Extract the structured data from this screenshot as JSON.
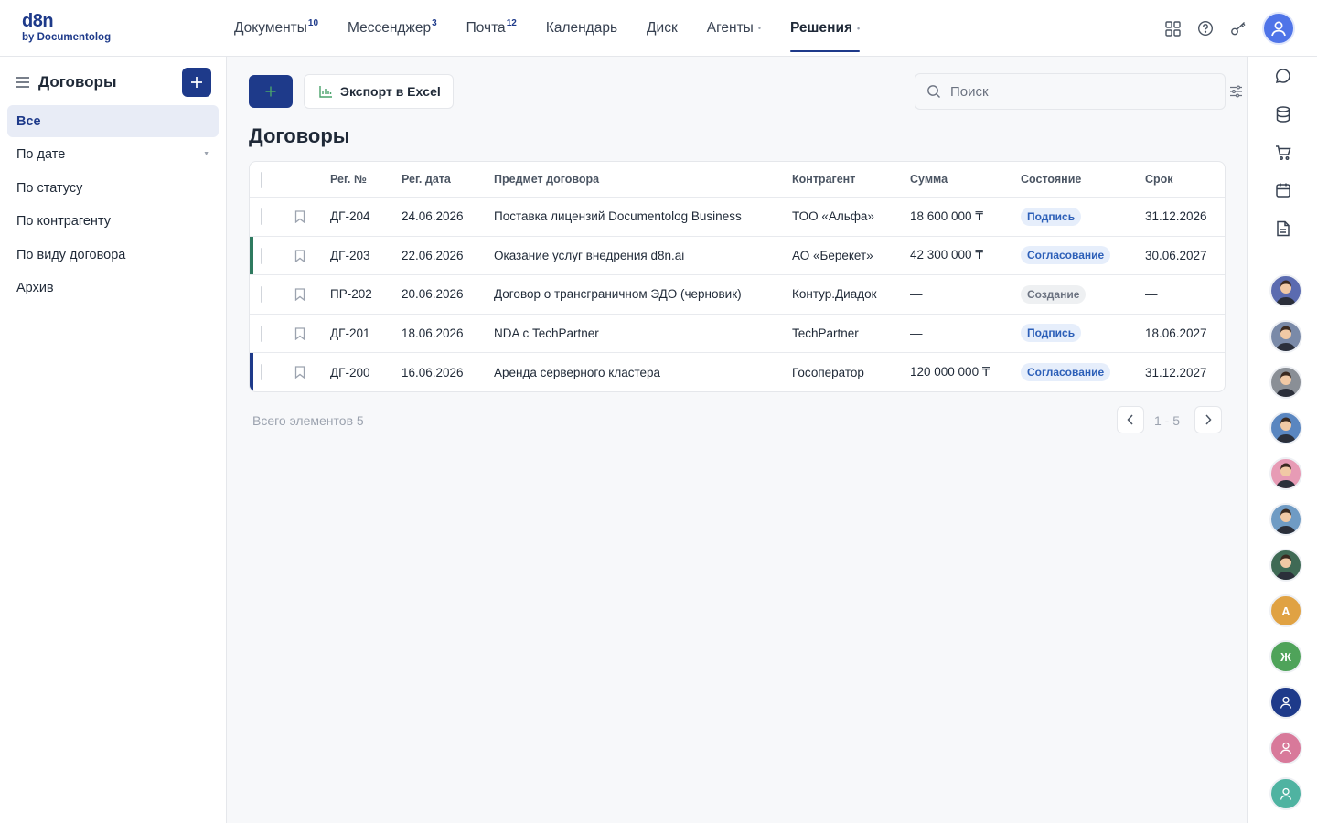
{
  "app": {
    "logo_line1": "d8n",
    "logo_line2": "by Documentolog",
    "brand_color": "#1e3a8a"
  },
  "nav": {
    "items": [
      {
        "label": "Документы",
        "badge": "10"
      },
      {
        "label": "Мессенджер",
        "badge": "3"
      },
      {
        "label": "Почта",
        "badge": "12"
      },
      {
        "label": "Календарь"
      },
      {
        "label": "Диск"
      },
      {
        "label": "Агенты",
        "dot": "•"
      },
      {
        "label": "Решения",
        "dot": "•",
        "active": true
      }
    ],
    "actions": [
      "apps-grid-icon",
      "help-icon",
      "key-icon",
      "user-avatar"
    ]
  },
  "sidebar": {
    "title": "Договоры",
    "items": [
      {
        "label": "Все",
        "active": true
      },
      {
        "label": "По дате",
        "caret": "▼"
      },
      {
        "label": "По статусу"
      },
      {
        "label": "По контрагенту"
      },
      {
        "label": "По виду договора"
      },
      {
        "label": "Архив"
      }
    ]
  },
  "toolbar": {
    "export_label": "Экспорт в Excel",
    "search_placeholder": "Поиск"
  },
  "page": {
    "title": "Договоры"
  },
  "table": {
    "columns": [
      "Рег. №",
      "Рег. дата",
      "Предмет договора",
      "Контрагент",
      "Сумма",
      "Состояние",
      "Срок"
    ],
    "rows": [
      {
        "reg_no": "ДГ-204",
        "reg_date": "24.06.2026",
        "subject": "Поставка лицензий Documentolog Business",
        "counterparty": "ТОО «Альфа»",
        "amount": "18 600 000 ₸",
        "status": "Подпись",
        "status_color": "blue",
        "deadline": "31.12.2026",
        "accent": ""
      },
      {
        "reg_no": "ДГ-203",
        "reg_date": "22.06.2026",
        "subject": "Оказание услуг внедрения d8n.ai",
        "counterparty": "АО «Берекет»",
        "amount": "42 300 000 ₸",
        "status": "Согласование",
        "status_color": "blue",
        "deadline": "30.06.2027",
        "accent": "#2f7a5f"
      },
      {
        "reg_no": "ПР-202",
        "reg_date": "20.06.2026",
        "subject": "Договор о трансграничном ЭДО (черновик)",
        "counterparty": "Контур.Диадок",
        "amount": "—",
        "status": "Создание",
        "status_color": "gray",
        "deadline": "—",
        "accent": ""
      },
      {
        "reg_no": "ДГ-201",
        "reg_date": "18.06.2026",
        "subject": "NDA с TechPartner",
        "counterparty": "TechPartner",
        "amount": "—",
        "status": "Подпись",
        "status_color": "blue",
        "deadline": "18.06.2027",
        "accent": ""
      },
      {
        "reg_no": "ДГ-200",
        "reg_date": "16.06.2026",
        "subject": "Аренда серверного кластера",
        "counterparty": "Госоператор",
        "amount": "120 000 000 ₸",
        "status": "Согласование",
        "status_color": "blue",
        "deadline": "31.12.2027",
        "accent": "#1e3a8a"
      }
    ]
  },
  "footer": {
    "total": "Всего элементов 5",
    "range": "1 - 5"
  },
  "rail": {
    "icons": [
      "chat-icon",
      "database-icon",
      "cart-icon",
      "calendar-icon",
      "document-icon"
    ],
    "avatars": [
      {
        "color": "#5b6bb0"
      },
      {
        "color": "#7a8aa8"
      },
      {
        "color": "#8a8f96"
      },
      {
        "color": "#5a86c0"
      },
      {
        "color": "#e79bb5"
      },
      {
        "color": "#6f9bc4"
      },
      {
        "color": "#3f6a55"
      },
      {
        "color": "#e0a243",
        "letter": "А"
      },
      {
        "color": "#4fa35a",
        "letter": "Ж"
      },
      {
        "color": "#1e3a8a",
        "icon": true
      },
      {
        "color": "#d8799a",
        "icon": true
      },
      {
        "color": "#4fb3a1",
        "icon": true
      }
    ]
  }
}
